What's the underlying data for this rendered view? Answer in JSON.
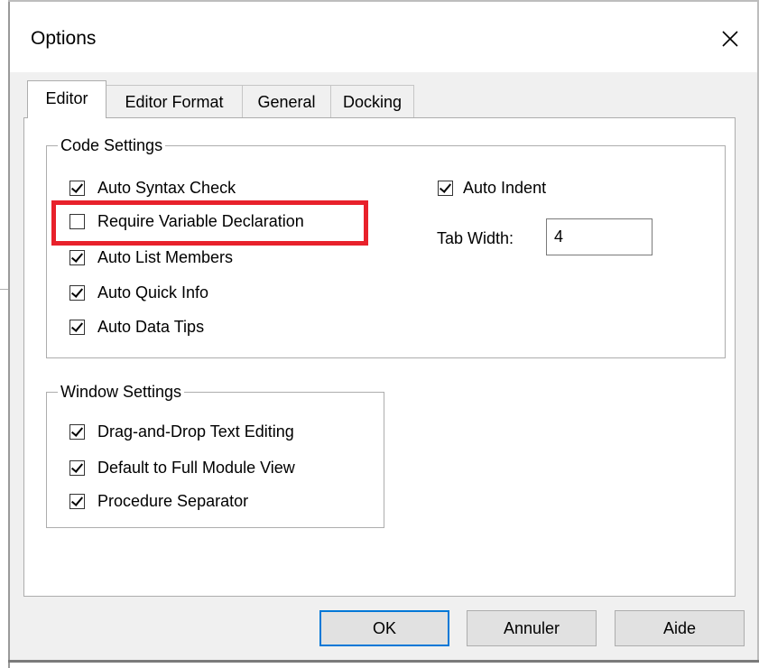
{
  "window": {
    "title": "Options",
    "close_icon": "close-icon"
  },
  "tabs": [
    {
      "label": "Editor",
      "active": true
    },
    {
      "label": "Editor Format",
      "active": false
    },
    {
      "label": "General",
      "active": false
    },
    {
      "label": "Docking",
      "active": false
    }
  ],
  "code_settings": {
    "title": "Code Settings",
    "checkboxes": [
      {
        "label": "Auto Syntax Check",
        "checked": true
      },
      {
        "label": "Require Variable Declaration",
        "checked": false
      },
      {
        "label": "Auto List Members",
        "checked": true
      },
      {
        "label": "Auto Quick Info",
        "checked": true
      },
      {
        "label": "Auto Data Tips",
        "checked": true
      }
    ],
    "auto_indent": {
      "label": "Auto Indent",
      "checked": true
    },
    "tab_width": {
      "label": "Tab Width:",
      "value": "4"
    }
  },
  "window_settings": {
    "title": "Window Settings",
    "checkboxes": [
      {
        "label": "Drag-and-Drop Text Editing",
        "checked": true
      },
      {
        "label": "Default to Full Module View",
        "checked": true
      },
      {
        "label": "Procedure Separator",
        "checked": true
      }
    ]
  },
  "buttons": {
    "ok": "OK",
    "cancel": "Annuler",
    "help": "Aide"
  },
  "colors": {
    "highlight": "#e8212b",
    "focus_border": "#0078d7",
    "dialog_bg": "#f0f0f0"
  }
}
